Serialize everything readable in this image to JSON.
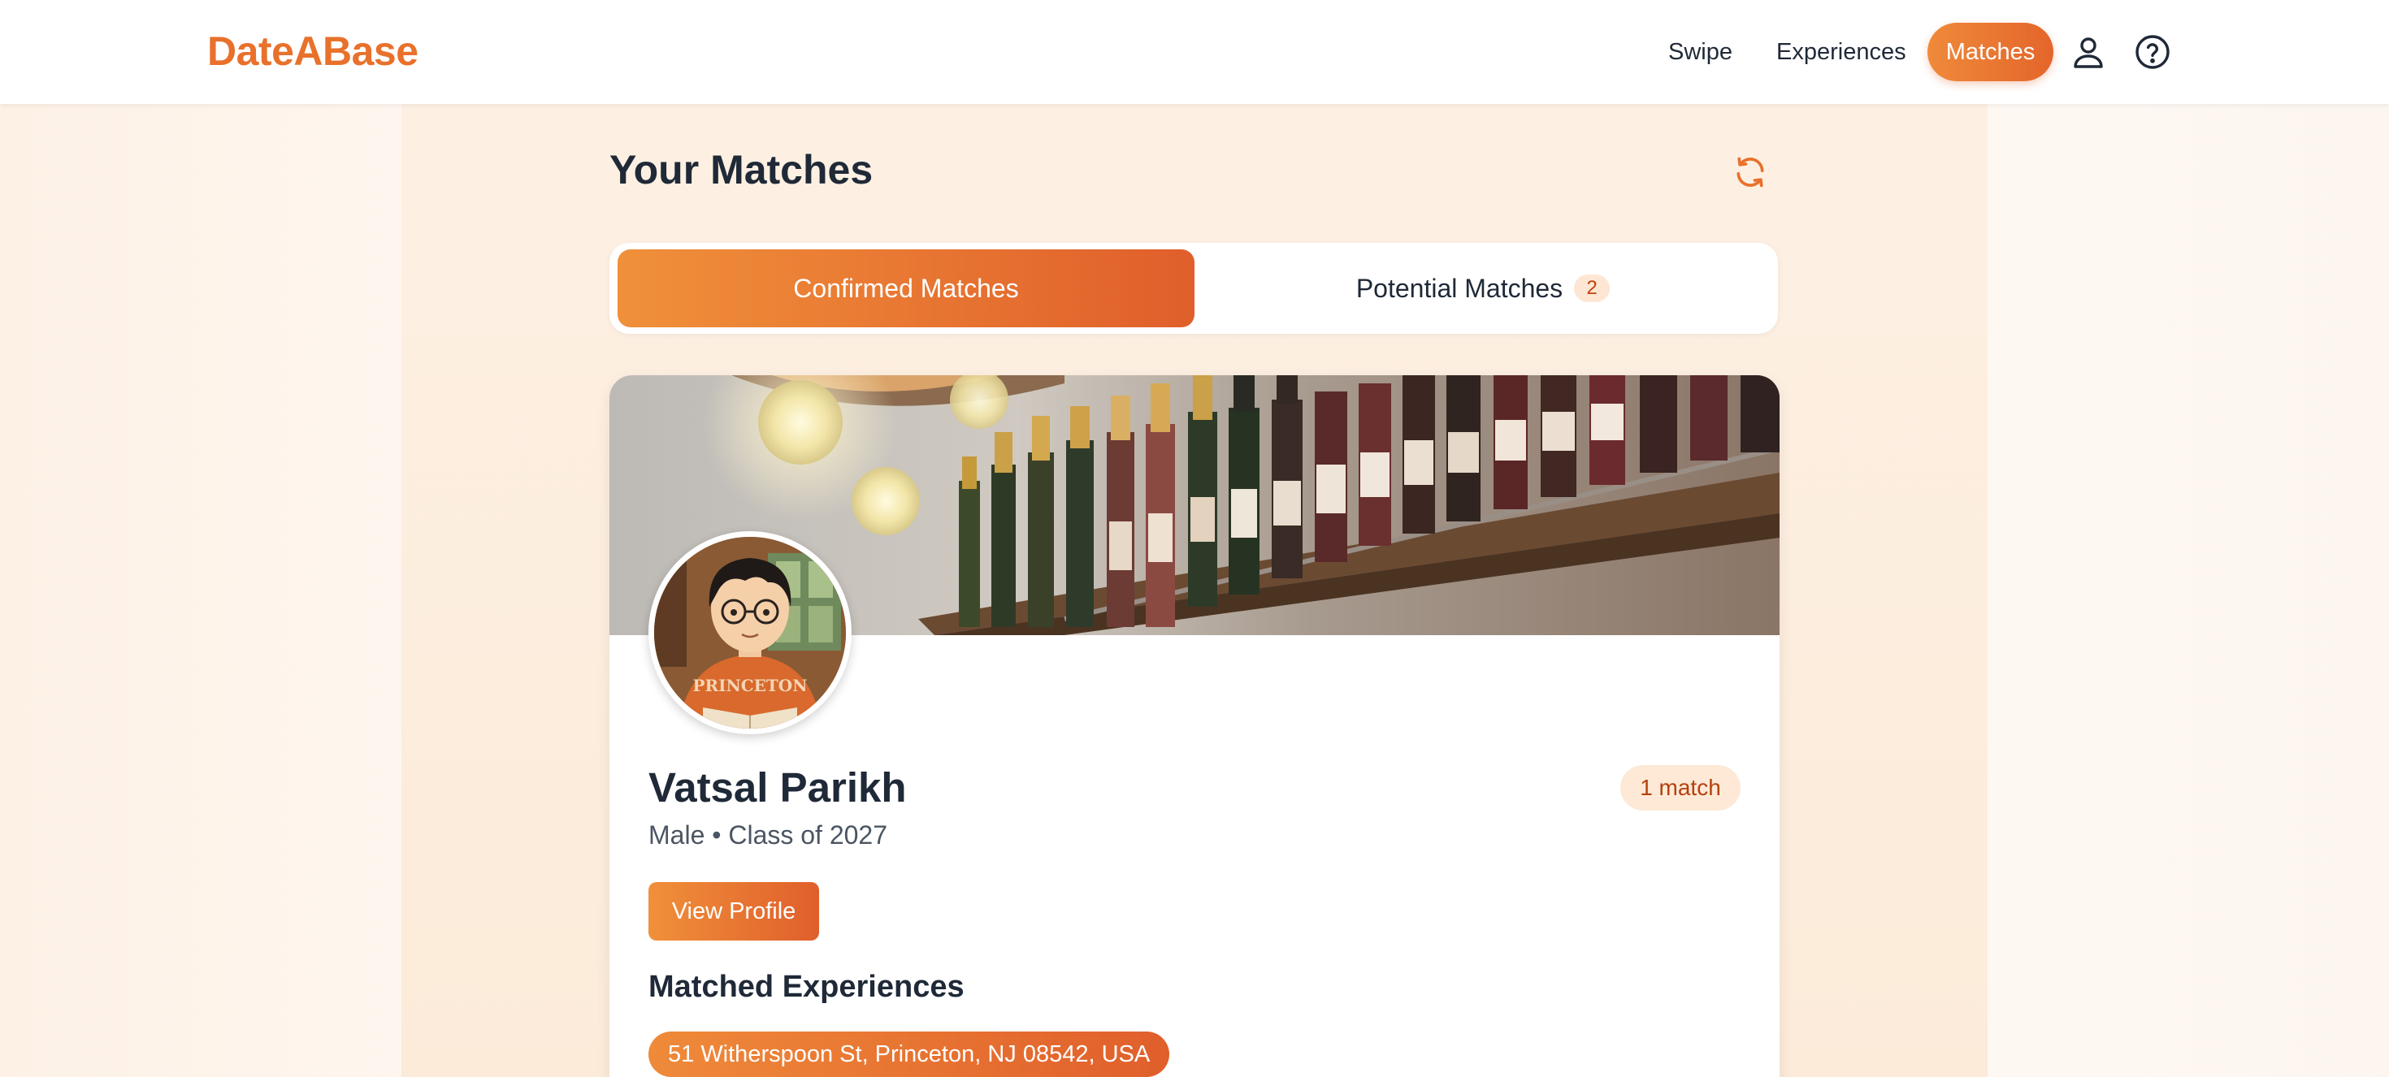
{
  "header": {
    "brand": "DateABase",
    "nav": {
      "swipe": "Swipe",
      "experiences": "Experiences",
      "matches": "Matches"
    },
    "icons": [
      "user-icon",
      "help-icon"
    ]
  },
  "page": {
    "title": "Your Matches",
    "refresh_icon": "refresh-icon"
  },
  "tabs": {
    "confirmed": "Confirmed Matches",
    "potential": "Potential Matches",
    "potential_count": "2",
    "active": "confirmed"
  },
  "match_card": {
    "name": "Vatsal Parikh",
    "meta": "Male • Class of 2027",
    "match_count": "1 match",
    "view_profile": "View Profile",
    "matched_experiences_title": "Matched Experiences",
    "experiences": [
      "51 Witherspoon St, Princeton, NJ 08542, USA"
    ],
    "avatar_shirt_text": "PRINCETON"
  },
  "colors": {
    "brand": "#e8712c",
    "accent_start": "#f0903a",
    "accent_end": "#e05f2b",
    "badge_bg": "#fde9d6",
    "badge_text": "#b4410f"
  }
}
